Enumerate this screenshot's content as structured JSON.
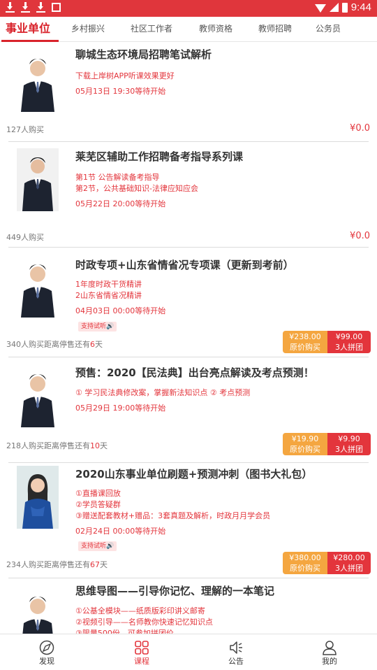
{
  "status_bar": {
    "time": "9:44"
  },
  "tabs": [
    {
      "label": "事业单位",
      "active": true
    },
    {
      "label": "乡村振兴"
    },
    {
      "label": "社区工作者"
    },
    {
      "label": "教师资格"
    },
    {
      "label": "教师招聘"
    },
    {
      "label": "公务员"
    }
  ],
  "courses": [
    {
      "title": "聊城生态环境局招聘笔试解析",
      "lines": [
        "下载上岸树APP听课效果更好"
      ],
      "time": "05月13日 19:30等待开始",
      "buyers": "127人购买",
      "price": "¥0.0"
    },
    {
      "title": "莱芜区辅助工作招聘备考指导系列课",
      "lines": [
        "第1节  公告解读备考指导",
        "第2节，公共基础知识-法律应知应会"
      ],
      "time": "05月22日 20:00等待开始",
      "buyers": "449人购买",
      "price": "¥0.0"
    },
    {
      "title": "时政专项+山东省情省况专项课（更新到考前）",
      "lines": [
        "1年度时政干货精讲",
        "2山东省情省况精讲"
      ],
      "time": "04月03日 00:00等待开始",
      "trial": "支持试听🔊",
      "buyers_prefix": "340人购买距离停售还有",
      "buyers_days": "6",
      "buyers_suffix": "天",
      "orig_price": "¥238.00",
      "orig_label": "原价购买",
      "group_price": "¥99.00",
      "group_label": "3人拼团"
    },
    {
      "title": "预售：2020【民法典】出台亮点解读及考点预测！",
      "lines": [
        "① 学习民法典修改案，掌握新法知识点  ② 考点预测"
      ],
      "time": "05月29日 19:00等待开始",
      "buyers_prefix": "218人购买距离停售还有",
      "buyers_days": "10",
      "buyers_suffix": "天",
      "orig_price": "¥19.90",
      "orig_label": "原价购买",
      "group_price": "¥9.90",
      "group_label": "3人拼团"
    },
    {
      "title": "2020山东事业单位刷题+预测冲刺（图书大礼包）",
      "lines": [
        "①直播课回放",
        "②学员答疑群",
        "③赠送配套教材+赠品：3套真题及解析，时政月月学会员"
      ],
      "time": "02月24日 00:00等待开始",
      "trial": "支持试听🔊",
      "buyers_prefix": "234人购买距离停售还有",
      "buyers_days": "67",
      "buyers_suffix": "天",
      "orig_price": "¥380.00",
      "orig_label": "原价购买",
      "group_price": "¥280.00",
      "group_label": "3人拼团"
    },
    {
      "title": "思维导图——引导你记忆、理解的一本笔记",
      "lines": [
        "①公基全模块——纸质版彩印讲义邮寄",
        "②视频引导——名师教你快速记忆知识点",
        "③限量500份，可参加拼团价"
      ]
    }
  ],
  "bottom_nav": [
    {
      "label": "发现",
      "icon": "compass-icon"
    },
    {
      "label": "课程",
      "icon": "grid-icon",
      "active": true
    },
    {
      "label": "公告",
      "icon": "speaker-icon"
    },
    {
      "label": "我的",
      "icon": "user-icon"
    }
  ],
  "colors": {
    "accent": "#e3353c",
    "status_bar": "#e0363c",
    "orig_button": "#f4a640"
  }
}
